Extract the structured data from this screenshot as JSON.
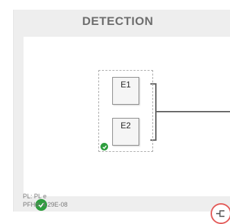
{
  "panel": {
    "title": "DETECTION",
    "blocks": [
      {
        "label": "E1"
      },
      {
        "label": "E2"
      }
    ],
    "info": {
      "pl": "PL: PL e",
      "pfhd": "PFHd: 4.29E-08"
    },
    "status_color": "#2e9e3e",
    "highlight_color": "#e35b59"
  },
  "icons": {
    "group_status": "check-circle-icon",
    "panel_status": "check-circle-icon",
    "split_button": "split-channel-icon"
  }
}
